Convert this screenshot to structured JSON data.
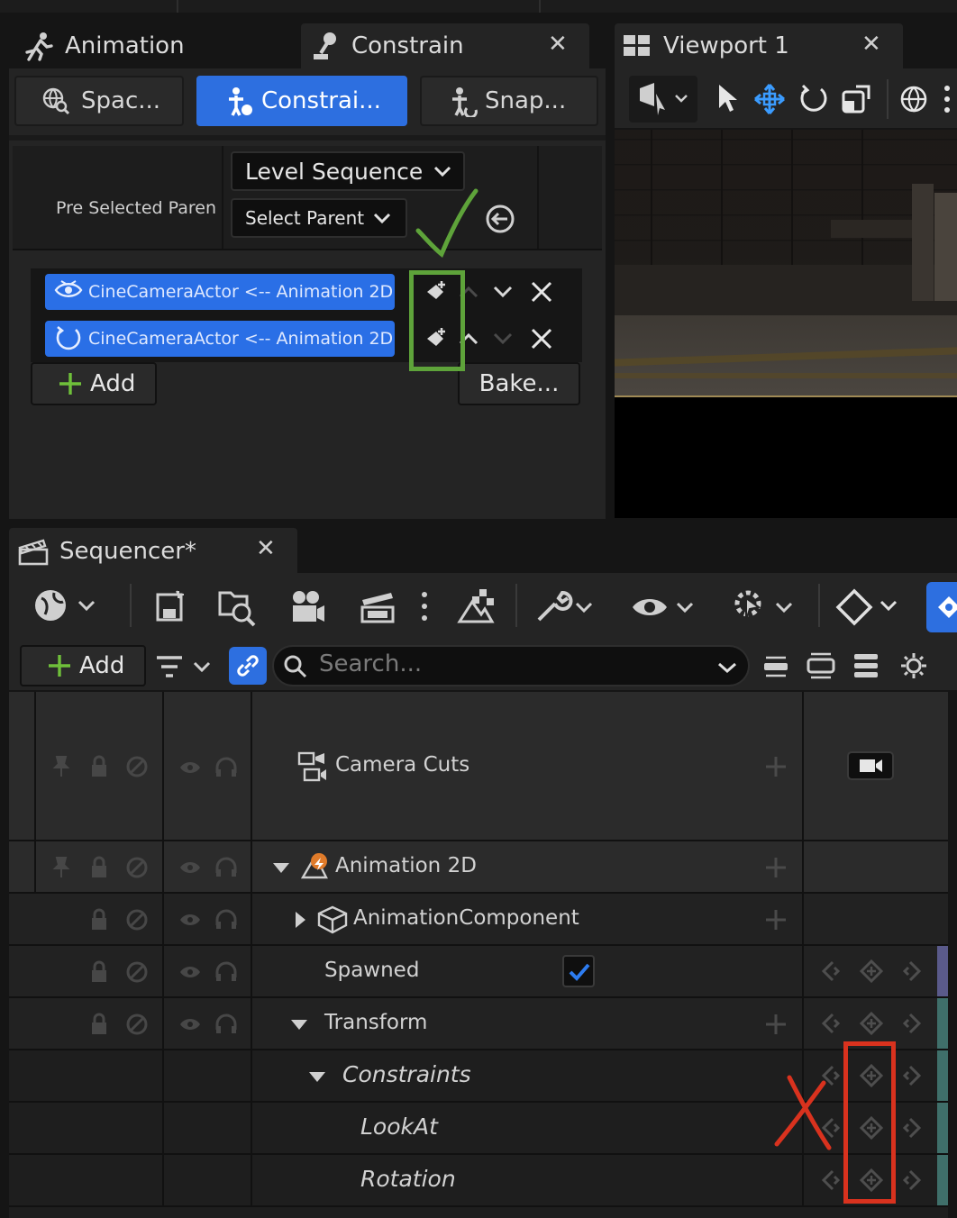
{
  "tabs": {
    "animation": "Animation",
    "constrain": "Constrain",
    "viewport": "Viewport 1",
    "sequencer": "Sequencer*"
  },
  "constrain_panel": {
    "mode_buttons": [
      "Spac...",
      "Constrai...",
      "Snap..."
    ],
    "level_sequence_dropdown": "Level Sequence",
    "pre_selected_label": "Pre Selected Paren",
    "select_parent_dropdown": "Select Parent",
    "constraints": [
      {
        "label": "CineCameraActor <-- Animation 2D",
        "icon": "lookat-eye-icon"
      },
      {
        "label": "CineCameraActor <-- Animation 2D",
        "icon": "rotation-icon"
      }
    ],
    "add_label": "Add",
    "bake_label": "Bake..."
  },
  "sequencer": {
    "add_label": "Add",
    "search_placeholder": "Search...",
    "tracks": [
      {
        "label": "Camera Cuts",
        "italic": false
      },
      {
        "label": "Animation 2D",
        "italic": false
      },
      {
        "label": "AnimationComponent",
        "italic": false
      },
      {
        "label": "Spawned",
        "italic": false
      },
      {
        "label": "Transform",
        "italic": false
      },
      {
        "label": "Constraints",
        "italic": true
      },
      {
        "label": "LookAt",
        "italic": true
      },
      {
        "label": "Rotation",
        "italic": true
      }
    ],
    "spawned_checked": true
  },
  "annotations": {
    "check_color": "#5ea33a",
    "cross_color": "#d9321e"
  }
}
